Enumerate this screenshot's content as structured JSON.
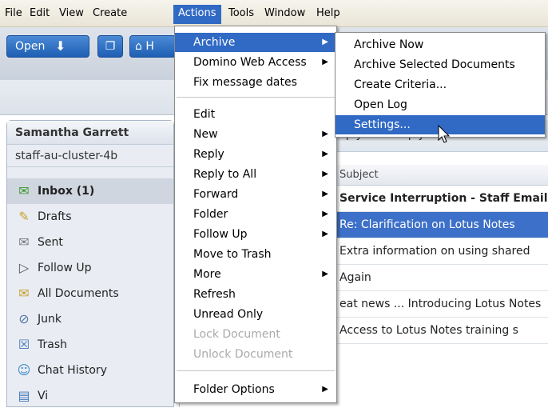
{
  "menubar": {
    "items": [
      "File",
      "Edit",
      "View",
      "Create",
      "Actions",
      "Tools",
      "Window",
      "Help"
    ]
  },
  "toolbar": {
    "open_label": "Open",
    "home_fragment": "H"
  },
  "sidebar": {
    "user": "Samantha Garrett",
    "server": "staff-au-cluster-4b",
    "items": [
      {
        "label": "Inbox (1)",
        "icon": "inbox-icon"
      },
      {
        "label": "Drafts",
        "icon": "drafts-icon"
      },
      {
        "label": "Sent",
        "icon": "sent-icon"
      },
      {
        "label": "Follow Up",
        "icon": "flag-icon"
      },
      {
        "label": "All Documents",
        "icon": "documents-icon"
      },
      {
        "label": "Junk",
        "icon": "junk-icon"
      },
      {
        "label": "Trash",
        "icon": "trash-icon"
      },
      {
        "label": "Chat History",
        "icon": "chat-history-icon"
      },
      {
        "label": "Vi",
        "icon": "views-icon"
      }
    ]
  },
  "mainview": {
    "action_reply": "Reply",
    "action_reply_all": "Reply to All",
    "column_subject": "Subject",
    "rows": [
      "Service Interruption - Staff Email",
      "Re: Clarification on Lotus Notes",
      "Extra information on using shared",
      "Again",
      "eat news ... Introducing Lotus Notes",
      "Access to Lotus Notes training s"
    ]
  },
  "actions_menu": {
    "items": [
      {
        "label": "Archive",
        "submenu": true
      },
      {
        "label": "Domino Web Access",
        "submenu": true
      },
      {
        "label": "Fix message dates",
        "submenu": false
      },
      {
        "label": "Edit",
        "submenu": false
      },
      {
        "label": "New",
        "submenu": true
      },
      {
        "label": "Reply",
        "submenu": true
      },
      {
        "label": "Reply to All",
        "submenu": true
      },
      {
        "label": "Forward",
        "submenu": true
      },
      {
        "label": "Folder",
        "submenu": true
      },
      {
        "label": "Follow Up",
        "submenu": true
      },
      {
        "label": "Move to Trash",
        "submenu": false
      },
      {
        "label": "More",
        "submenu": true
      },
      {
        "label": "Refresh",
        "submenu": false
      },
      {
        "label": "Unread Only",
        "submenu": false
      },
      {
        "label": "Lock Document",
        "disabled": true
      },
      {
        "label": "Unlock Document",
        "disabled": true
      },
      {
        "label": "Folder Options",
        "submenu": true
      }
    ]
  },
  "archive_menu": {
    "items": [
      "Archive Now",
      "Archive Selected Documents",
      "Create Criteria...",
      "Open Log",
      "Settings..."
    ]
  },
  "colors": {
    "highlight": "#316ac5",
    "selected_row": "#3d70c8"
  }
}
